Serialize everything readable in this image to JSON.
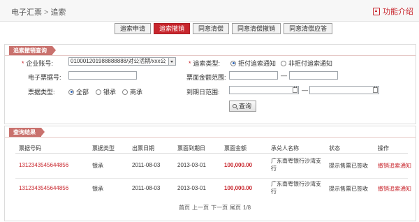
{
  "header": {
    "breadcrumb_root": "电子汇票",
    "breadcrumb_sep": ">",
    "breadcrumb_current": "追索",
    "help_label": "功能介绍"
  },
  "tabs": [
    {
      "label": "追索申请",
      "active": false
    },
    {
      "label": "追索撤销",
      "active": true
    },
    {
      "label": "同意清偿",
      "active": false
    },
    {
      "label": "同意清偿撤销",
      "active": false
    },
    {
      "label": "同意清偿应答",
      "active": false
    }
  ],
  "query": {
    "title": "追索撤销查询",
    "account_label": "企业账号:",
    "account_value": "010001201988888888/对公活期/xxx公",
    "notice_type_label": "追索类型:",
    "notice_type_options": [
      "拒付追索通知",
      "非拒付追索通知"
    ],
    "notice_type_selected": 0,
    "bill_no_label": "电子票据号:",
    "bill_no_value": "",
    "amount_label": "票面金额范围:",
    "dash": "—",
    "bill_type_label": "票据类型:",
    "bill_type_options": [
      "全部",
      "银承",
      "商承"
    ],
    "bill_type_selected": 0,
    "due_date_label": "到期日范围:",
    "search_button": "查询"
  },
  "results": {
    "title": "查询结果",
    "columns": [
      "票据号码",
      "票据类型",
      "出票日期",
      "票面到期日",
      "票面金额",
      "承兑人名称",
      "状态",
      "操作"
    ],
    "rows": [
      {
        "bill_no": "1312343545644856",
        "type": "银承",
        "issue_date": "2011-08-03",
        "due_date": "2013-03-01",
        "amount": "100,000.00",
        "acceptor": "广东南粤银行沙湾支行",
        "status": "提示售票已签收",
        "action": "撤销追索通知"
      },
      {
        "bill_no": "1312343545644856",
        "type": "银承",
        "issue_date": "2011-08-03",
        "due_date": "2013-03-01",
        "amount": "100,000.00",
        "acceptor": "广东南粤银行沙湾支行",
        "status": "提示售票已签收",
        "action": "撤销追索通知"
      }
    ]
  },
  "pagination": {
    "first": "首页",
    "prev": "上一页",
    "next": "下一页",
    "last": "尾页",
    "page": "1/8"
  },
  "colors": {
    "accent_red": "#c8262d",
    "section_title_bg": "#c9716d"
  }
}
